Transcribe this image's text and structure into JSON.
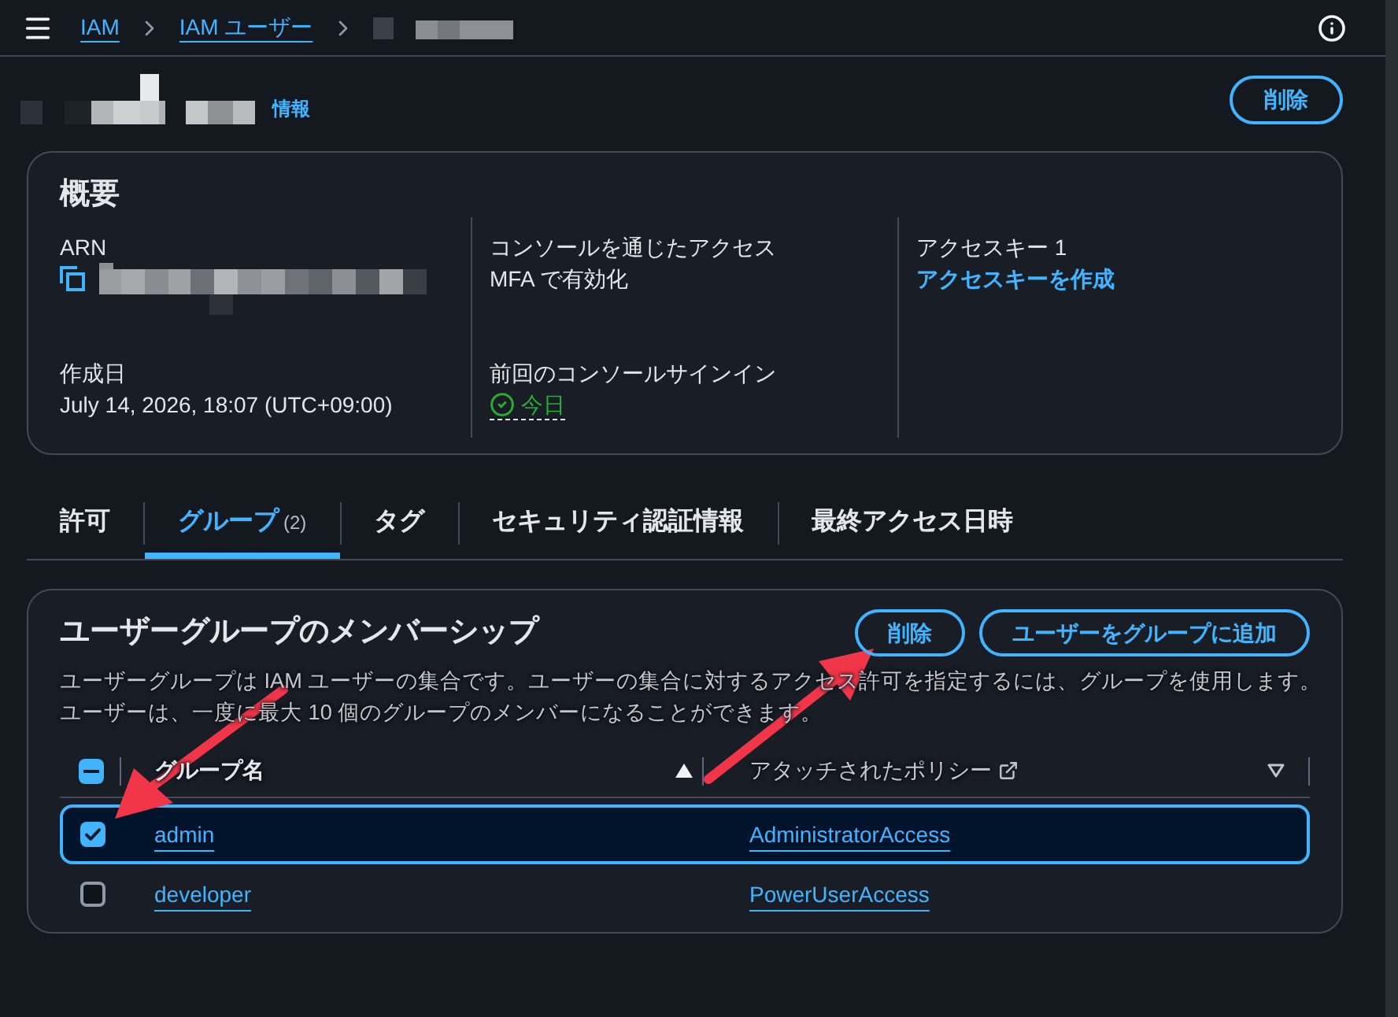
{
  "top_bar": {
    "breadcrumbs": [
      {
        "label": "IAM"
      },
      {
        "label": "IAM ユーザー"
      }
    ]
  },
  "header": {
    "info_link": "情報",
    "delete_button": "削除"
  },
  "summary": {
    "title": "概要",
    "columns": [
      [
        {
          "kind": "arn",
          "label": "ARN"
        },
        {
          "kind": "text",
          "label": "作成日",
          "value": "July 14, 2026, 18:07 (UTC+09:00)"
        }
      ],
      [
        {
          "kind": "text",
          "label": "コンソールを通じたアクセス",
          "value": "MFA で有効化"
        },
        {
          "kind": "status",
          "label": "前回のコンソールサインイン",
          "value": "今日"
        }
      ],
      [
        {
          "kind": "link",
          "label": "アクセスキー 1",
          "value": "アクセスキーを作成"
        }
      ]
    ]
  },
  "tabs": [
    {
      "label": "許可",
      "selected": false
    },
    {
      "label": "グループ",
      "count": "(2)",
      "selected": true
    },
    {
      "label": "タグ",
      "selected": false
    },
    {
      "label": "セキュリティ認証情報",
      "selected": false
    },
    {
      "label": "最終アクセス日時",
      "selected": false
    }
  ],
  "groups_panel": {
    "title": "ユーザーグループのメンバーシップ",
    "buttons": [
      "削除",
      "ユーザーをグループに追加"
    ],
    "description": "ユーザーグループは IAM ユーザーの集合です。ユーザーの集合に対するアクセス許可を指定するには、グループを使用します。ユーザーは、一度に最大 10 個のグループのメンバーになることができます。",
    "table": {
      "select_all_indeterminate": true,
      "columns": [
        {
          "label": "グループ名",
          "sorted": true
        },
        {
          "label": "アタッチされたポリシー",
          "sorted": false,
          "external_link": true
        }
      ],
      "rows": [
        {
          "selected": true,
          "group": "admin",
          "policy": "AdministratorAccess"
        },
        {
          "selected": false,
          "group": "developer",
          "policy": "PowerUserAccess"
        }
      ]
    }
  }
}
